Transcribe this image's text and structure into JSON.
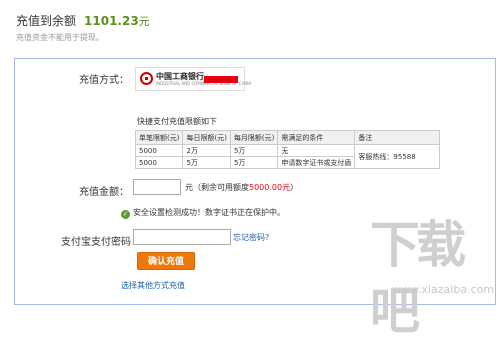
{
  "header": {
    "title_label": "充值到余额",
    "balance": "1101.23",
    "balance_unit": "元",
    "note": "充值资金不能用于提现。"
  },
  "form": {
    "method_label": "充值方式：",
    "bank_name": "中国工商银行",
    "bank_name_en": "INDUSTRIAL AND COMMERCIAL BANK OF CHINA",
    "limit_title": "快捷支付充值限额如下",
    "limit_table": {
      "headers": [
        "单笔限额(元)",
        "每日限额(元)",
        "每月限额(元)",
        "需满足的条件",
        "备注"
      ],
      "rows": [
        [
          "5000",
          "2万",
          "5万",
          "无"
        ],
        [
          "5000",
          "5万",
          "5万",
          "申请数字证书或支付盾"
        ]
      ],
      "note": "客服热线：95588"
    },
    "amount_label": "充值金额：",
    "amount_value": "",
    "amount_unit": "元",
    "amount_hint_prefix": "（剩余可用额度",
    "amount_hint_value": "5000.00元",
    "amount_hint_suffix": "）",
    "security_text": "安全设置检测成功！数字证书正在保护中。",
    "password_label": "支付宝支付密码：",
    "forgot_link": "忘记密码?",
    "confirm_button": "确认充值",
    "other_link": "选择其他方式充值"
  },
  "watermark": {
    "logo_text": "下载吧",
    "url": "www.xiazaiba.com"
  },
  "colors": {
    "accent_orange": "#f0780a",
    "balance_green": "#5a8f1b",
    "link_blue": "#1a5fb4",
    "alert_red": "#e60012",
    "panel_border": "#aab9e8"
  }
}
